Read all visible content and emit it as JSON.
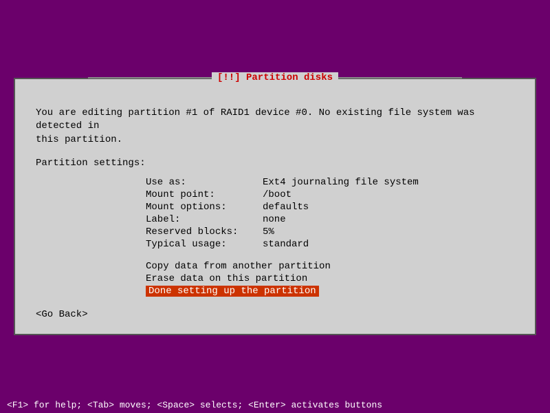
{
  "window": {
    "title": "[!!] Partition disks",
    "background_color": "#6b006b"
  },
  "content": {
    "intro_line1": "You are editing partition #1 of RAID1 device #0. No existing file system was detected in",
    "intro_line2": "this partition.",
    "section_header": "Partition settings:",
    "settings": [
      {
        "label": "Use as:",
        "value": "Ext4 journaling file system"
      },
      {
        "label": "Mount point:",
        "value": "/boot"
      },
      {
        "label": "Mount options:",
        "value": "defaults"
      },
      {
        "label": "Label:",
        "value": "none"
      },
      {
        "label": "Reserved blocks:",
        "value": "5%"
      },
      {
        "label": "Typical usage:",
        "value": "standard"
      }
    ],
    "actions": [
      {
        "label": "Copy data from another partition",
        "highlighted": false
      },
      {
        "label": "Erase data on this partition",
        "highlighted": false
      },
      {
        "label": "Done setting up the partition",
        "highlighted": true
      }
    ],
    "go_back": "<Go Back>"
  },
  "status_bar": {
    "text": "<F1> for help; <Tab> moves; <Space> selects; <Enter> activates buttons"
  }
}
